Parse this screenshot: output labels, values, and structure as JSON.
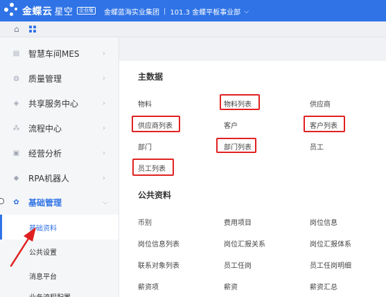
{
  "topbar": {
    "brand": "金蝶云",
    "brand_sub": "星空",
    "edition": "企业版",
    "org": "金蝶蓝海实业集团",
    "dept": "101.3 金蝶平板事业部",
    "dept_chevron": "⌵"
  },
  "subbar": {
    "home_icon": "⌂"
  },
  "sidebar": {
    "items": [
      {
        "label": "智慧车间MES",
        "icon": "chart-bar-icon",
        "glyph": "▤",
        "chevron": "›"
      },
      {
        "label": "质量管理",
        "icon": "shield-icon",
        "glyph": "◍",
        "chevron": "›"
      },
      {
        "label": "共享服务中心",
        "icon": "share-icon",
        "glyph": "◈",
        "chevron": "›"
      },
      {
        "label": "流程中心",
        "icon": "flow-icon",
        "glyph": "⁂",
        "chevron": "›"
      },
      {
        "label": "经营分析",
        "icon": "analysis-icon",
        "glyph": "▣",
        "chevron": "›"
      },
      {
        "label": "RPA机器人",
        "icon": "robot-icon",
        "glyph": "◆",
        "chevron": "›"
      },
      {
        "label": "基础管理",
        "icon": "gear-icon",
        "glyph": "✿",
        "chevron": "⌵"
      }
    ],
    "subitems": [
      {
        "label": "基础资料"
      },
      {
        "label": "公共设置"
      },
      {
        "label": "消息平台"
      },
      {
        "label": "业务流程配置"
      }
    ]
  },
  "main": {
    "sections": [
      {
        "title": "主数据",
        "links": [
          "物料",
          "物料列表",
          "供应商",
          "供应商列表",
          "客户",
          "客户列表",
          "部门",
          "部门列表",
          "员工",
          "员工列表"
        ]
      },
      {
        "title": "公共资料",
        "links": [
          "币别",
          "费用项目",
          "岗位信息",
          "岗位信息列表",
          "岗位汇报关系",
          "岗位汇报体系",
          "联系对象列表",
          "员工任岗",
          "员工任岗明细",
          "薪资项",
          "薪资",
          "薪资汇总"
        ]
      }
    ]
  },
  "colors": {
    "brand": "#2f73e6",
    "highlight": "#e02020"
  }
}
